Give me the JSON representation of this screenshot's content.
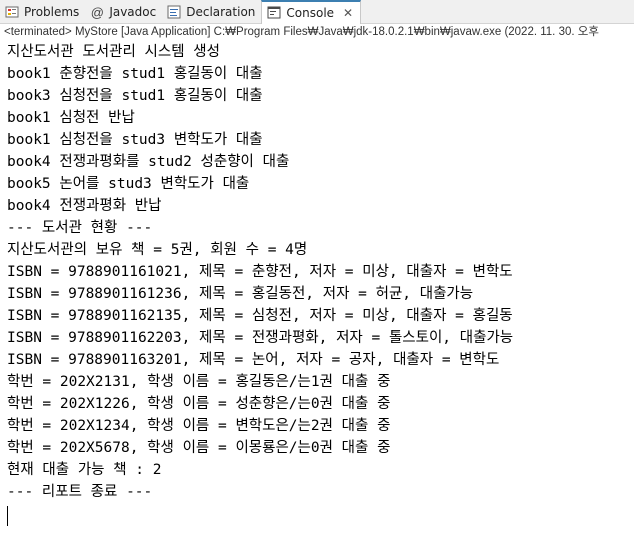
{
  "tabs": [
    {
      "label": "Problems",
      "icon": "problems-icon",
      "active": false
    },
    {
      "label": "Javadoc",
      "icon": "at-icon",
      "active": false
    },
    {
      "label": "Declaration",
      "icon": "declaration-icon",
      "active": false
    },
    {
      "label": "Console",
      "icon": "console-icon",
      "active": true,
      "close": "✕"
    }
  ],
  "status": "<terminated> MyStore [Java Application] C:₩Program Files₩Java₩jdk-18.0.2.1₩bin₩javaw.exe  (2022. 11. 30. 오후 ",
  "console": {
    "lines": [
      "지산도서관 도서관리 시스템 생성",
      "book1 춘향전을 stud1 홍길동이 대출",
      "book3 심청전을 stud1 홍길동이 대출",
      "book1 심청전 반납",
      "book1 심청전을 stud3 변학도가 대출",
      "book4 전쟁과평화를 stud2 성춘향이 대출",
      "book5 논어를 stud3 변학도가 대출",
      "book4 전쟁과평화 반납",
      "--- 도서관 현황 ---",
      "지산도서관의 보유 책 = 5권, 회원 수 = 4명",
      "ISBN = 9788901161021, 제목 = 춘향전, 저자 = 미상, 대출자 = 변학도",
      "ISBN = 9788901161236, 제목 = 홍길동전, 저자 = 허균, 대출가능",
      "ISBN = 9788901162135, 제목 = 심청전, 저자 = 미상, 대출자 = 홍길동",
      "ISBN = 9788901162203, 제목 = 전쟁과평화, 저자 = 톨스토이, 대출가능",
      "ISBN = 9788901163201, 제목 = 논어, 저자 = 공자, 대출자 = 변학도",
      "학번 = 202X2131, 학생 이름 = 홍길동은/는1권 대출 중",
      "학번 = 202X1226, 학생 이름 = 성춘향은/는0권 대출 중",
      "학번 = 202X1234, 학생 이름 = 변학도은/는2권 대출 중",
      "학번 = 202X5678, 학생 이름 = 이몽룡은/는0권 대출 중",
      "현재 대출 가능 책 : 2",
      "--- 리포트 종료 ---"
    ]
  },
  "colors": {
    "tab_bar_bg": "#f0f0f0",
    "active_tab_accent": "#3c7fb1",
    "console_text": "#000000"
  }
}
